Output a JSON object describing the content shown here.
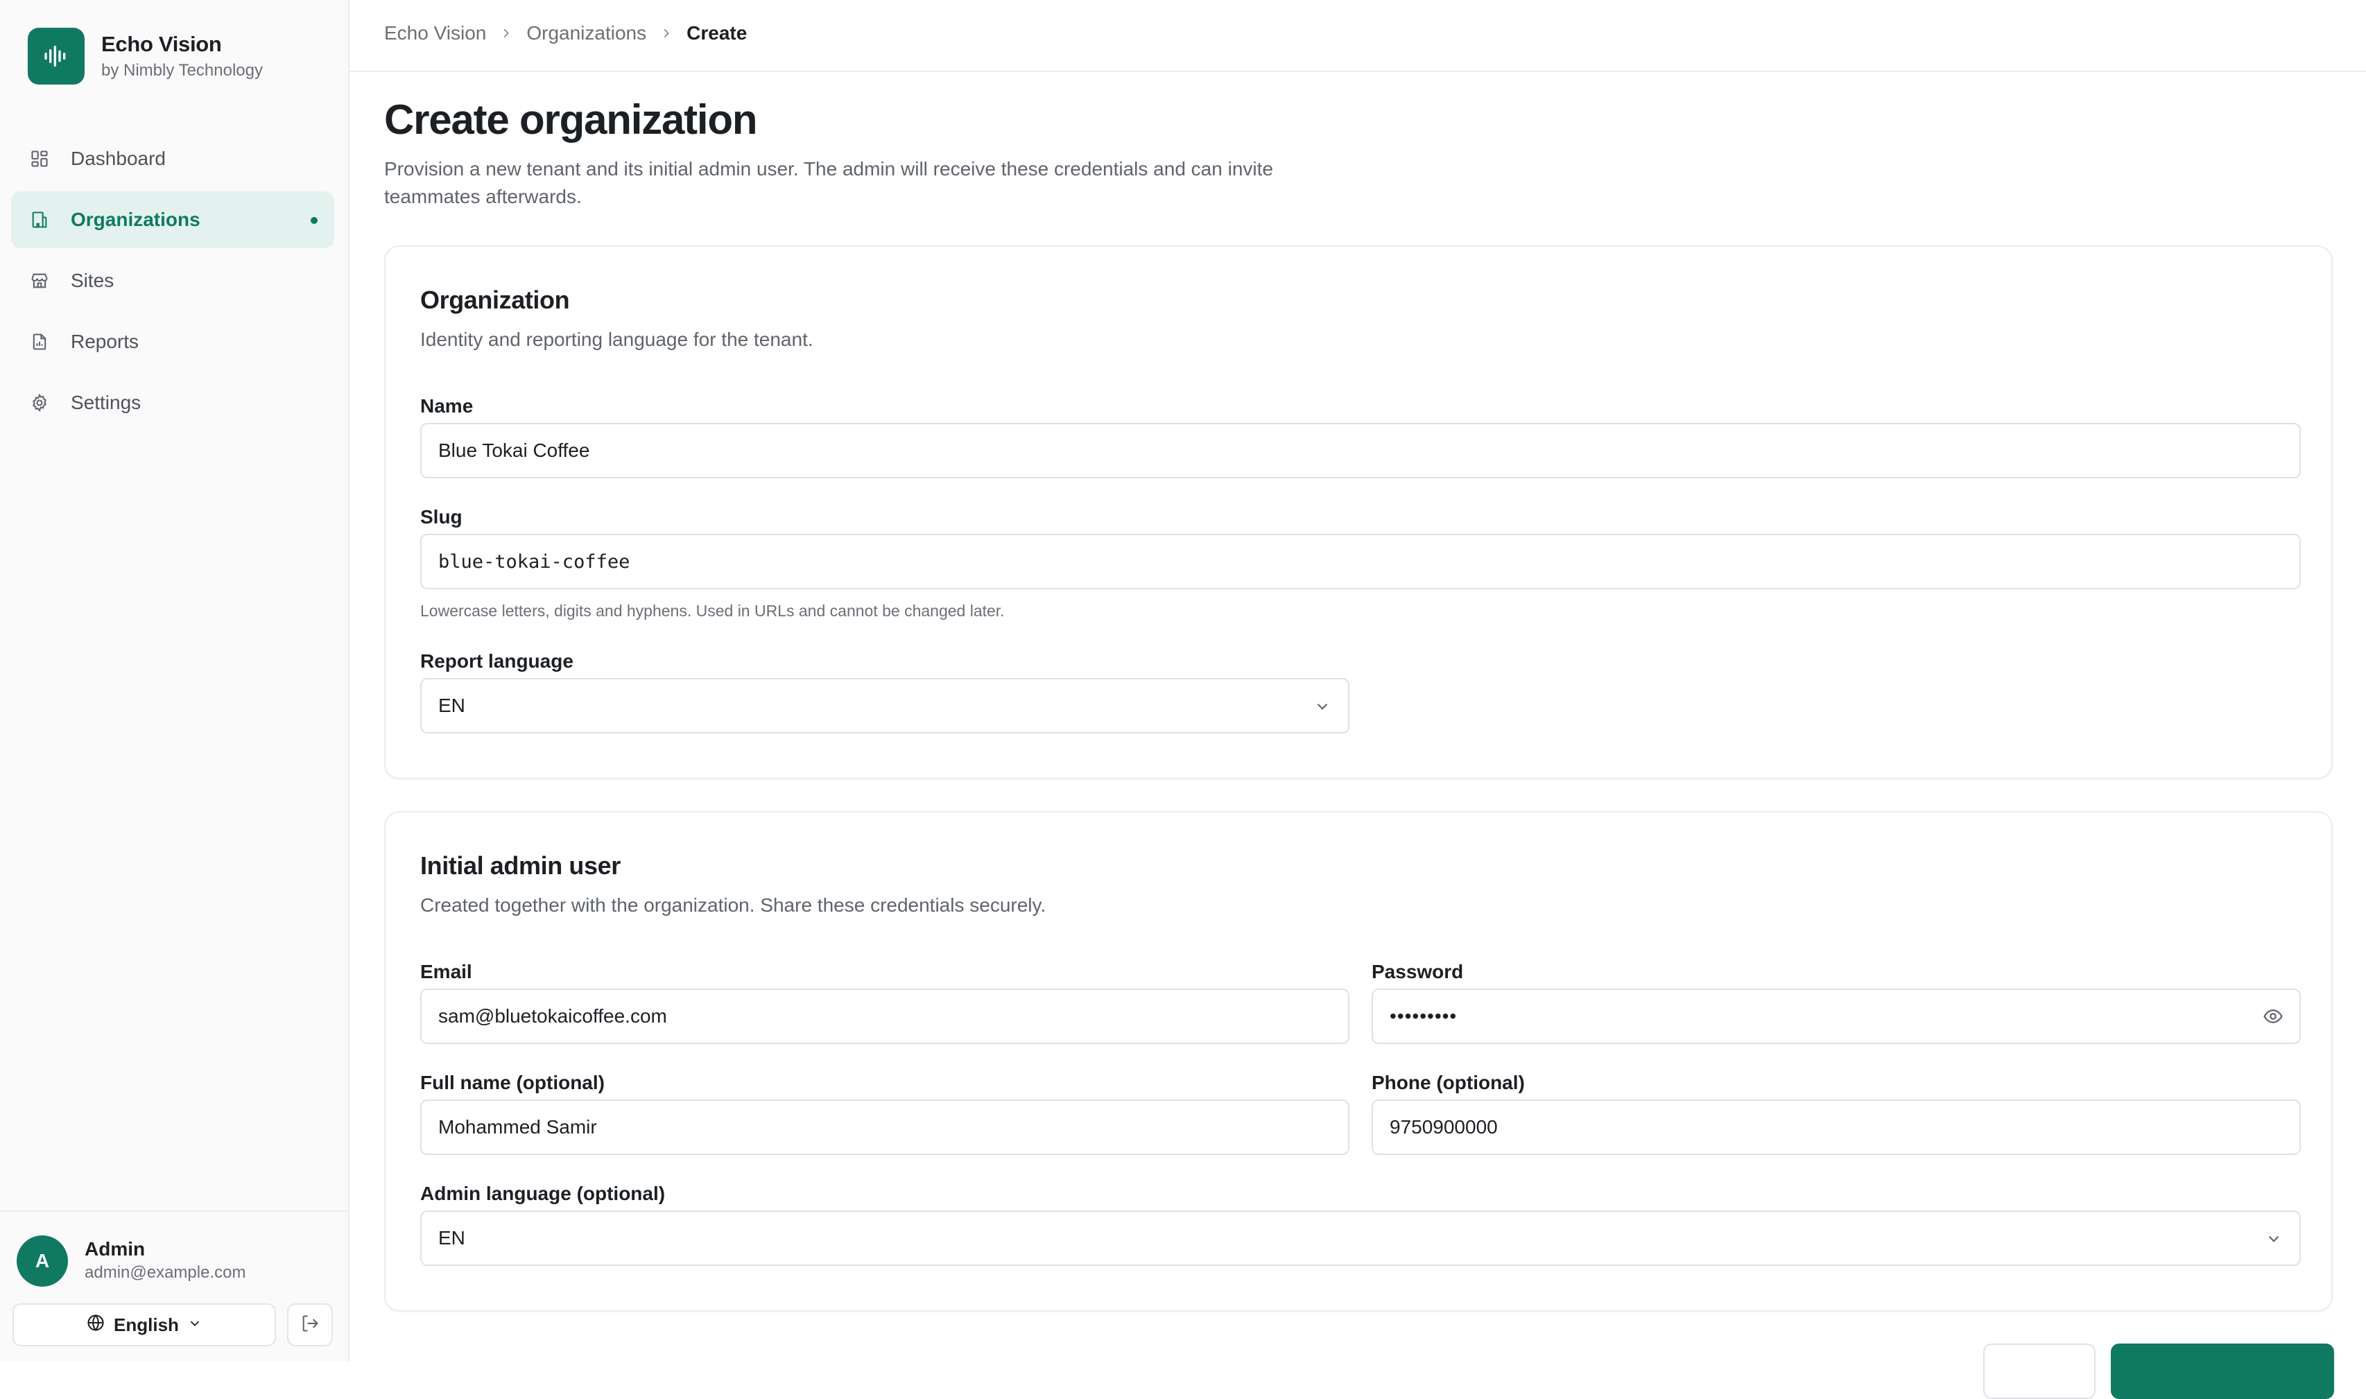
{
  "brand": {
    "title": "Echo Vision",
    "subtitle": "by Nimbly Technology",
    "logo_icon": "audio-waveform-icon",
    "accent_color": "#0f7a61"
  },
  "sidebar": {
    "items": [
      {
        "label": "Dashboard",
        "icon": "layout-grid-icon",
        "active": false
      },
      {
        "label": "Organizations",
        "icon": "building-icon",
        "active": true
      },
      {
        "label": "Sites",
        "icon": "store-icon",
        "active": false
      },
      {
        "label": "Reports",
        "icon": "file-chart-icon",
        "active": false
      },
      {
        "label": "Settings",
        "icon": "gear-icon",
        "active": false
      }
    ]
  },
  "user": {
    "initial": "A",
    "name": "Admin",
    "email": "admin@example.com",
    "language": "English"
  },
  "breadcrumb": {
    "items": [
      "Echo Vision",
      "Organizations"
    ],
    "current": "Create"
  },
  "page": {
    "title": "Create organization",
    "description": "Provision a new tenant and its initial admin user. The admin will receive these credentials and can invite teammates afterwards."
  },
  "organization_card": {
    "title": "Organization",
    "description": "Identity and reporting language for the tenant.",
    "name_label": "Name",
    "name_value": "Blue Tokai Coffee",
    "slug_label": "Slug",
    "slug_value": "blue-tokai-coffee",
    "slug_hint": "Lowercase letters, digits and hyphens. Used in URLs and cannot be changed later.",
    "report_language_label": "Report language",
    "report_language_value": "EN"
  },
  "admin_card": {
    "title": "Initial admin user",
    "description": "Created together with the organization. Share these credentials securely.",
    "email_label": "Email",
    "email_value": "sam@bluetokaicoffee.com",
    "password_label": "Password",
    "password_value": "•••••••••",
    "full_name_label": "Full name (optional)",
    "full_name_value": "Mohammed Samir",
    "phone_label": "Phone (optional)",
    "phone_value": "9750900000",
    "admin_language_label": "Admin language (optional)",
    "admin_language_value": "EN"
  },
  "actions": {
    "cancel_label": "",
    "submit_label": ""
  }
}
